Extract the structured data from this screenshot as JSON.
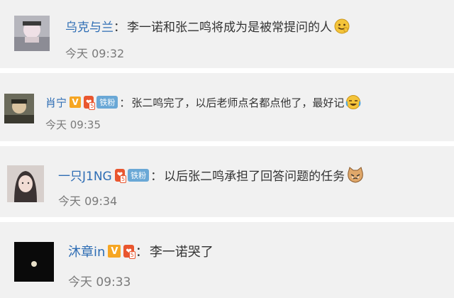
{
  "comments": [
    {
      "avatar": {
        "bg": "#b6b6bd",
        "fg": "#efe0e6"
      },
      "name": "乌克与兰",
      "colon": "：",
      "text": "李一诺和张二鸣将成为是被常提问的人",
      "emoji": "smile-emoji",
      "time": "今天 09:32"
    },
    {
      "avatar": {
        "bg": "#6b6b5b",
        "fg": "#d9c3a0"
      },
      "name": "肖宁",
      "badges": [
        {
          "type": "v",
          "label": "V"
        },
        {
          "type": "fan",
          "label": "",
          "num": "5"
        },
        {
          "type": "rail",
          "label": "铁粉"
        }
      ],
      "colon": "：",
      "text": "张二鸣完了，以后老师点名都点他了，最好记",
      "emoji": "laugh-cry-emoji",
      "time": "今天 09:35"
    },
    {
      "avatar": {
        "bg": "#d7cfcc",
        "fg": "#3b3333"
      },
      "name": "一只J1NG",
      "badges": [
        {
          "type": "fan",
          "label": "",
          "num": "5"
        },
        {
          "type": "rail",
          "label": "铁粉"
        }
      ],
      "colon": "：",
      "text": "以后张二鸣承担了回答问题的任务",
      "emoji": "cat-emoji",
      "time": "今天 09:34"
    },
    {
      "avatar": {
        "bg": "#0a0a0a",
        "fg": "#e7dfc9"
      },
      "name": "沐章in",
      "badges": [
        {
          "type": "v",
          "label": "V"
        },
        {
          "type": "fan",
          "label": "",
          "num": "5"
        }
      ],
      "colon": "：",
      "text": "李一诺哭了",
      "time": "今天 09:33"
    }
  ],
  "colors": {
    "name": "#2e6db4",
    "text": "#333333",
    "time": "#7a7a7a",
    "v_badge": "#f6a623",
    "fan_badge": "#e9562f",
    "rail_badge": "#6aa8d6",
    "background": "#f1f1f1"
  }
}
